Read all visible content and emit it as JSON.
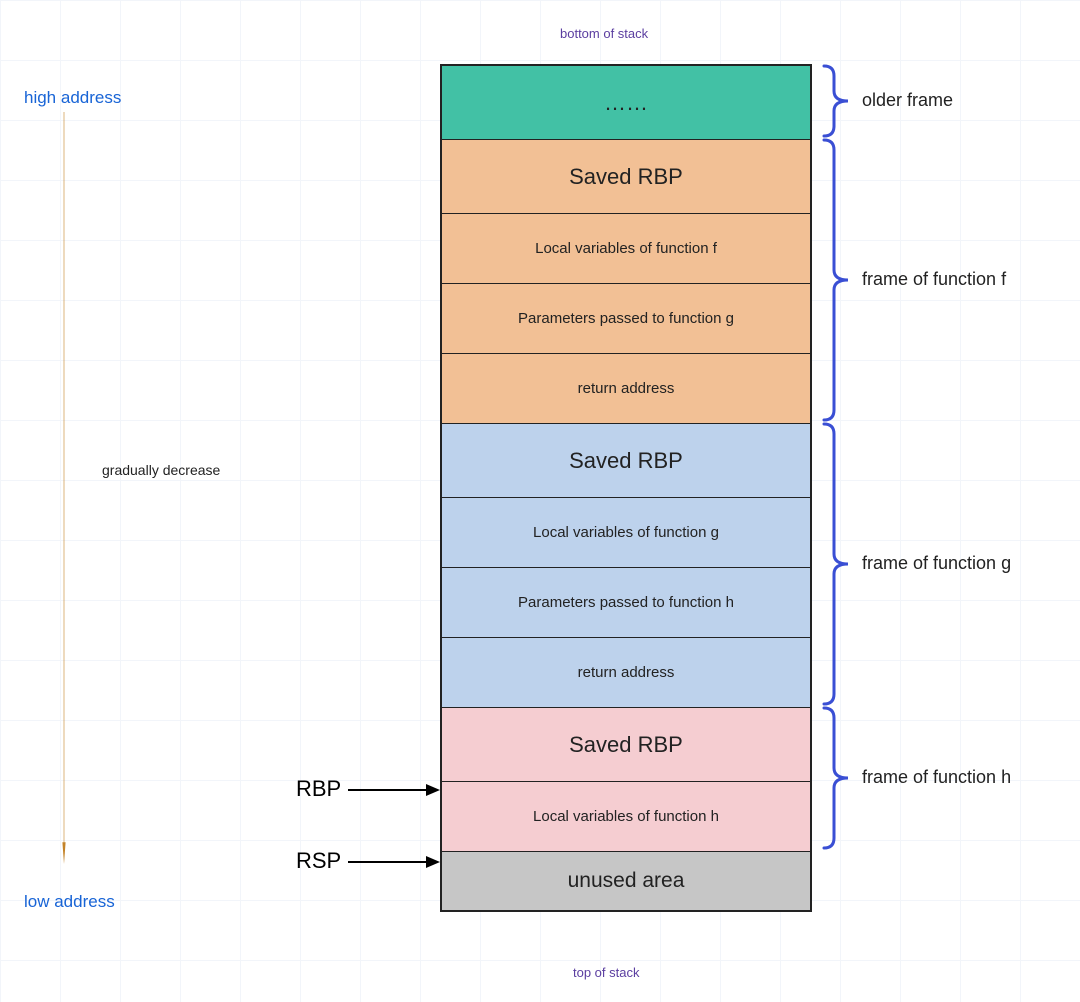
{
  "title_top": "bottom of stack",
  "title_bottom": "top of stack",
  "high_address": "high address",
  "low_address": "low address",
  "decrease": "gradually decrease",
  "pointers": {
    "rbp": "RBP",
    "rsp": "RSP"
  },
  "frames": {
    "older": "older frame",
    "f": "frame of function f",
    "g": "frame of function g",
    "h": "frame of function h"
  },
  "cells": [
    {
      "text": "……",
      "color": "teal",
      "h": "big"
    },
    {
      "text": "Saved RBP",
      "color": "orange",
      "h": "big"
    },
    {
      "text": "Local variables of function f",
      "color": "orange",
      "h": "mid"
    },
    {
      "text": "Parameters passed to function g",
      "color": "orange",
      "h": "mid"
    },
    {
      "text": "return address",
      "color": "orange",
      "h": "mid"
    },
    {
      "text": "Saved RBP",
      "color": "blue",
      "h": "big"
    },
    {
      "text": "Local variables of function g",
      "color": "blue",
      "h": "mid"
    },
    {
      "text": "Parameters passed to function h",
      "color": "blue",
      "h": "mid"
    },
    {
      "text": "return address",
      "color": "blue",
      "h": "mid"
    },
    {
      "text": "Saved RBP",
      "color": "pink",
      "h": "big"
    },
    {
      "text": "Local variables of function h",
      "color": "pink",
      "h": "mid"
    },
    {
      "text": "unused area",
      "color": "gray",
      "h": "small",
      "big_text": true
    }
  ],
  "colors": {
    "brace": "#3a4fd4",
    "arrow_orange": "#c48328",
    "arrow_black": "#000000"
  }
}
